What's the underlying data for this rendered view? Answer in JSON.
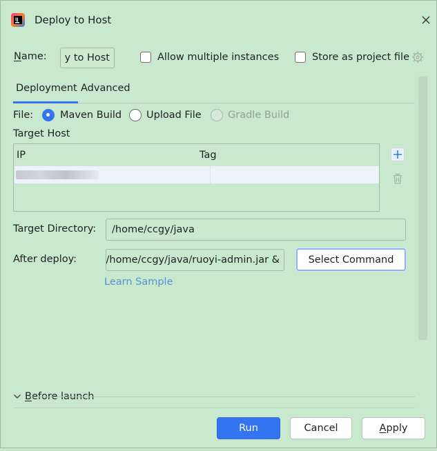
{
  "window": {
    "title": "Deploy to Host"
  },
  "name": {
    "label": "Name:",
    "value": "Deploy to Host",
    "visible_value": "y to Host"
  },
  "options": {
    "allow_multiple": {
      "label": "Allow multiple instances",
      "checked": false
    },
    "store_project": {
      "label": "Store as project file",
      "checked": false
    }
  },
  "tabs": [
    {
      "label": "Deployment",
      "selected": true
    },
    {
      "label": "Advanced",
      "selected": false
    }
  ],
  "file": {
    "label": "File:",
    "options": [
      {
        "label": "Maven Build",
        "selected": true,
        "enabled": true
      },
      {
        "label": "Upload File",
        "selected": false,
        "enabled": true
      },
      {
        "label": "Gradle Build",
        "selected": false,
        "enabled": false
      }
    ]
  },
  "target_host": {
    "label": "Target Host",
    "columns": [
      "IP",
      "Tag"
    ]
  },
  "target_directory": {
    "label": "Target Directory:",
    "value": "/home/ccgy/java"
  },
  "after_deploy": {
    "label": "After deploy:",
    "value": "/home/ccgy/java/ruoyi-admin.jar &",
    "select_command": "Select Command",
    "learn_sample": "Learn Sample"
  },
  "before_launch": {
    "label": "Before launch"
  },
  "footer": {
    "run": "Run",
    "cancel": "Cancel",
    "apply": "Apply"
  },
  "colors": {
    "background": "#c8e9cd",
    "accent": "#3574f0",
    "link": "#5a8fd8"
  }
}
